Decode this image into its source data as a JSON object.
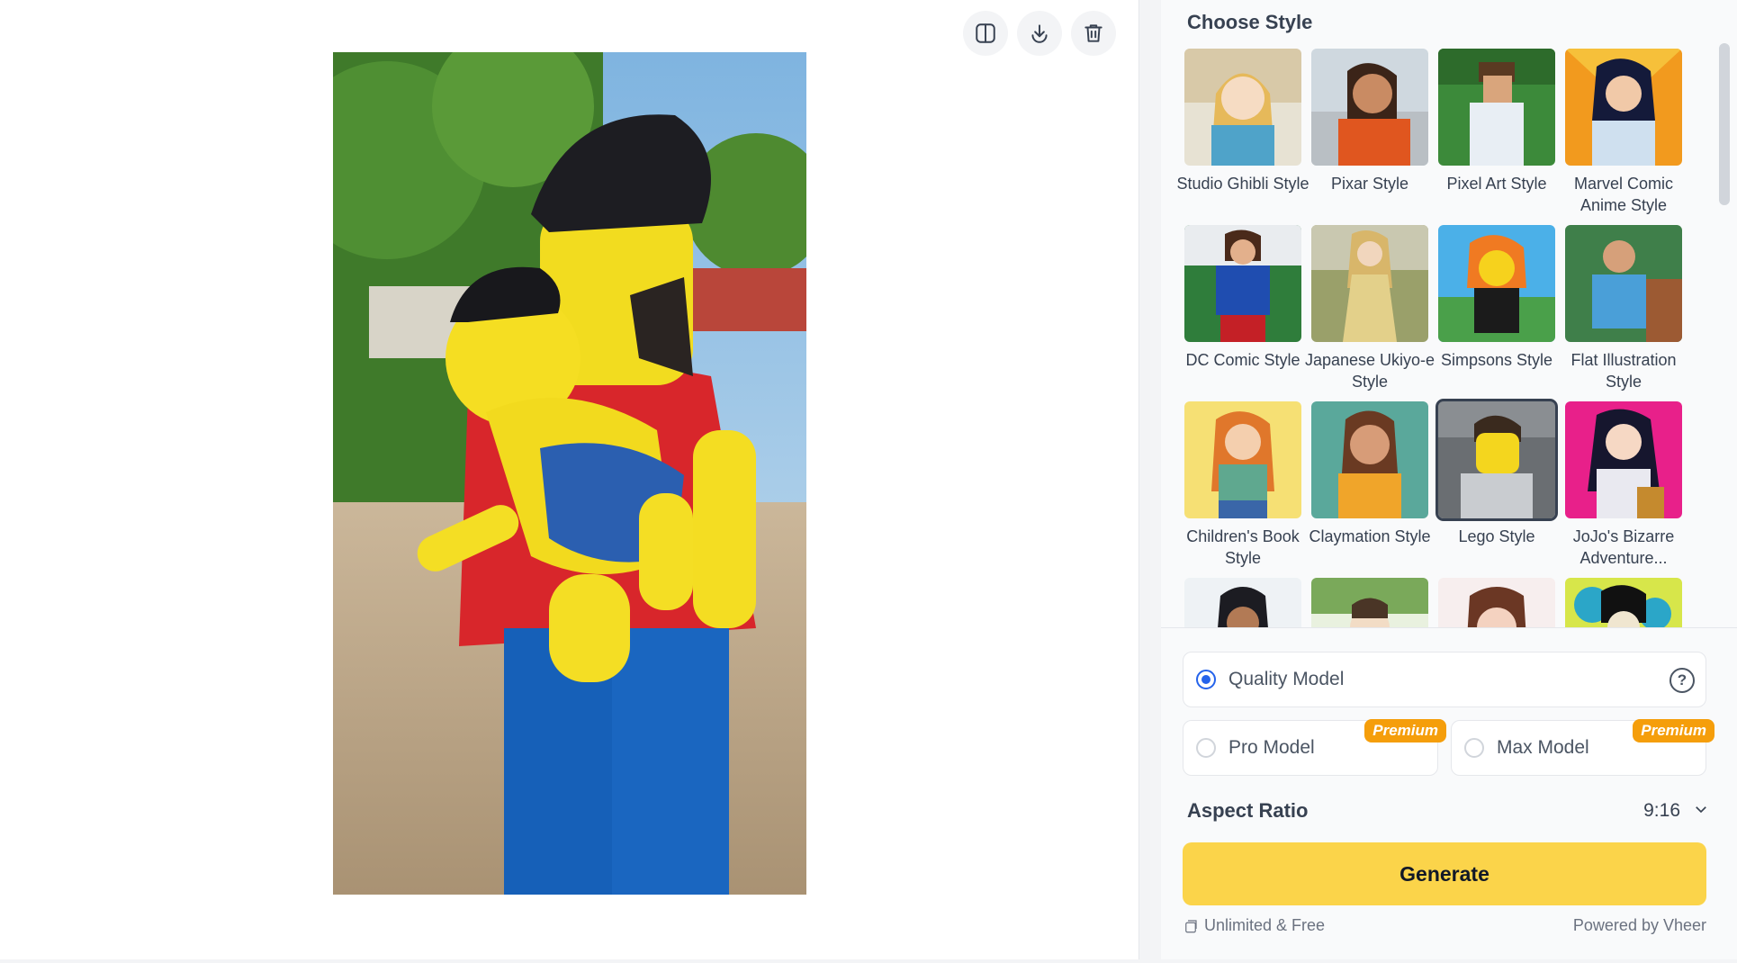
{
  "toolbar": {
    "compare_icon": "split-compare-icon",
    "download_icon": "download-icon",
    "delete_icon": "trash-icon"
  },
  "result_image": {
    "subject": "lego-style father holding baby"
  },
  "panel": {
    "choose_style_title": "Choose Style",
    "styles": [
      {
        "label": "Studio Ghibli Style",
        "selected": false
      },
      {
        "label": "Pixar Style",
        "selected": false
      },
      {
        "label": "Pixel Art Style",
        "selected": false
      },
      {
        "label": "Marvel Comic Anime Style",
        "selected": false
      },
      {
        "label": "DC Comic Style",
        "selected": false
      },
      {
        "label": "Japanese Ukiyo-e Style",
        "selected": false
      },
      {
        "label": "Simpsons Style",
        "selected": false
      },
      {
        "label": "Flat Illustration Style",
        "selected": false
      },
      {
        "label": "Children's Book Style",
        "selected": false
      },
      {
        "label": "Claymation Style",
        "selected": false
      },
      {
        "label": "Lego Style",
        "selected": true
      },
      {
        "label": "JoJo's Bizarre Adventure...",
        "selected": false
      }
    ],
    "models": {
      "quality": {
        "label": "Quality Model",
        "checked": true
      },
      "pro": {
        "label": "Pro Model",
        "badge": "Premium",
        "checked": false
      },
      "max": {
        "label": "Max Model",
        "badge": "Premium",
        "checked": false
      }
    },
    "aspect_ratio": {
      "title": "Aspect Ratio",
      "value": "9:16"
    },
    "generate_label": "Generate",
    "footer": {
      "left": "Unlimited & Free",
      "right": "Powered by Vheer"
    }
  },
  "colors": {
    "accent": "#fbd44a",
    "radio": "#2563eb",
    "premium": "#f59e0b"
  }
}
